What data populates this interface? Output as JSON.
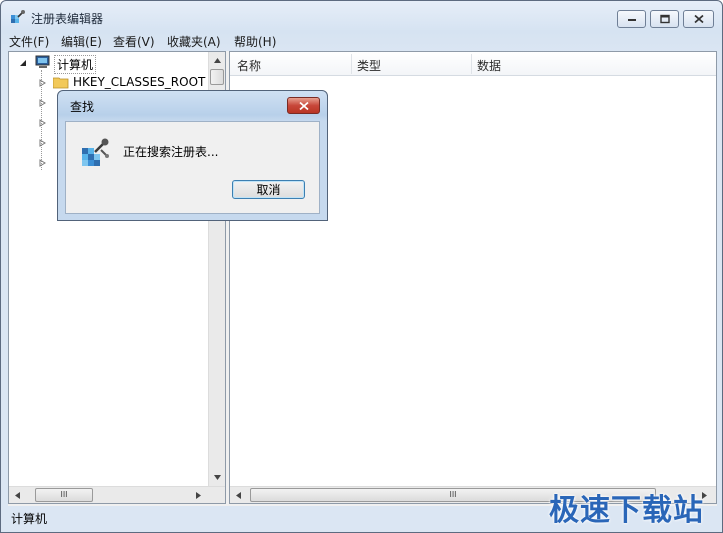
{
  "window": {
    "title": "注册表编辑器"
  },
  "menu": {
    "items": [
      {
        "label": "文件(F)"
      },
      {
        "label": "编辑(E)"
      },
      {
        "label": "查看(V)"
      },
      {
        "label": "收藏夹(A)"
      },
      {
        "label": "帮助(H)"
      }
    ]
  },
  "tree": {
    "root_label": "计算机",
    "first_child_label": "HKEY_CLASSES_ROOT"
  },
  "list": {
    "columns": [
      "名称",
      "类型",
      "数据"
    ]
  },
  "status": {
    "text": "计算机"
  },
  "dialog": {
    "title": "查找",
    "message": "正在搜索注册表...",
    "cancel_label": "取消"
  },
  "watermark": "极速下载站",
  "scrollbar": {
    "thumb_glyph": "III"
  },
  "colors": {
    "accent": "#3c7fb1",
    "close_button": "#c8473a",
    "watermark": "#2a66b8"
  }
}
